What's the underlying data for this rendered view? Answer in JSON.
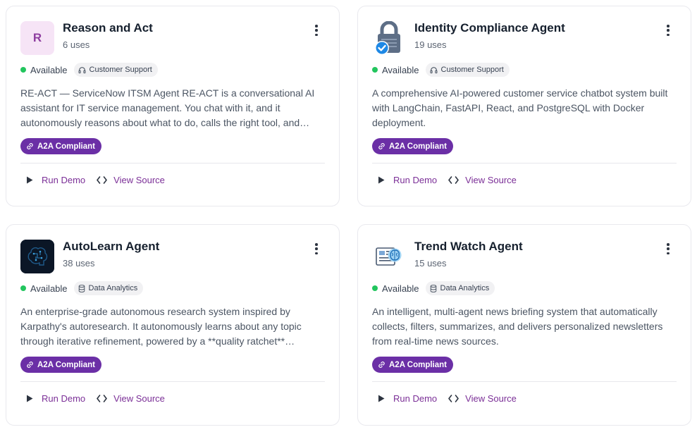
{
  "cards": [
    {
      "title": "Reason and Act",
      "uses": "6 uses",
      "avatar_letter": "R",
      "avatar_icon": "letter-avatar",
      "status": "Available",
      "category": "Customer Support",
      "category_icon": "headset-icon",
      "description": "RE-ACT — ServiceNow ITSM Agent RE-ACT is a conversational AI assistant for IT service management. You chat with it, and it autonomously reasons about what to do, calls the right tool, and responds with the result.",
      "badge": "A2A Compliant",
      "run_demo": "Run Demo",
      "view_source": "View Source"
    },
    {
      "title": "Identity Compliance Agent",
      "uses": "19 uses",
      "avatar_icon": "lock-check-icon",
      "status": "Available",
      "category": "Customer Support",
      "category_icon": "headset-icon",
      "description": "A comprehensive AI-powered customer service chatbot system built with LangChain, FastAPI, React, and PostgreSQL with Docker deployment.",
      "badge": "A2A Compliant",
      "run_demo": "Run Demo",
      "view_source": "View Source"
    },
    {
      "title": "AutoLearn Agent",
      "uses": "38 uses",
      "avatar_icon": "brain-circuit-icon",
      "status": "Available",
      "category": "Data Analytics",
      "category_icon": "database-icon",
      "description": "An enterprise-grade autonomous research system inspired by Karpathy's autoresearch. It autonomously learns about any topic through iterative refinement, powered by a **quality ratchet** mechanism.",
      "badge": "A2A Compliant",
      "run_demo": "Run Demo",
      "view_source": "View Source"
    },
    {
      "title": "Trend Watch Agent",
      "uses": "15 uses",
      "avatar_icon": "news-brain-icon",
      "status": "Available",
      "category": "Data Analytics",
      "category_icon": "database-icon",
      "description": "An intelligent, multi-agent news briefing system that automatically collects, filters, summarizes, and delivers personalized newsletters from real-time news sources.",
      "badge": "A2A Compliant",
      "run_demo": "Run Demo",
      "view_source": "View Source"
    }
  ],
  "colors": {
    "accent": "#7b2f97",
    "badge": "#6b2fa6",
    "status_available": "#22c55e",
    "avatar_letter_bg": "#f6e4f6"
  }
}
